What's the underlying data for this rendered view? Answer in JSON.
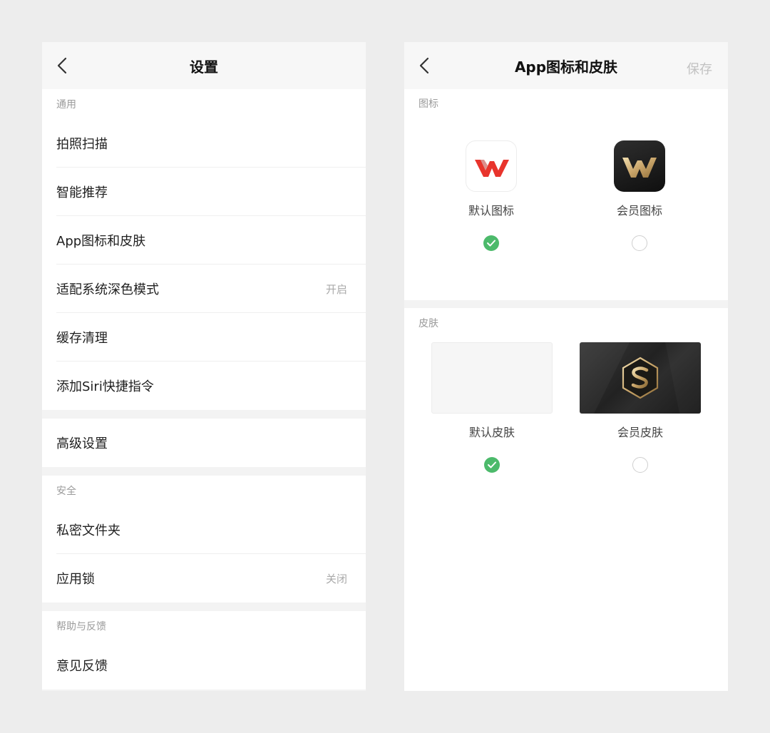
{
  "settings": {
    "title": "设置",
    "general": {
      "header": "通用",
      "items": [
        {
          "label": "拍照扫描",
          "value": ""
        },
        {
          "label": "智能推荐",
          "value": ""
        },
        {
          "label": "App图标和皮肤",
          "value": ""
        },
        {
          "label": "适配系统深色模式",
          "value": "开启"
        },
        {
          "label": "缓存清理",
          "value": ""
        },
        {
          "label": "添加Siri快捷指令",
          "value": ""
        }
      ]
    },
    "advanced": {
      "label": "高级设置"
    },
    "security": {
      "header": "安全",
      "items": [
        {
          "label": "私密文件夹",
          "value": ""
        },
        {
          "label": "应用锁",
          "value": "关闭"
        }
      ]
    },
    "help": {
      "header": "帮助与反馈",
      "items": [
        {
          "label": "意见反馈",
          "value": ""
        }
      ]
    }
  },
  "icon_skin": {
    "title": "App图标和皮肤",
    "save_label": "保存",
    "icons": {
      "header": "图标",
      "options": [
        {
          "label": "默认图标",
          "selected": true,
          "icon": "wps-default-icon"
        },
        {
          "label": "会员图标",
          "selected": false,
          "icon": "wps-member-icon"
        }
      ]
    },
    "skins": {
      "header": "皮肤",
      "options": [
        {
          "label": "默认皮肤",
          "selected": true
        },
        {
          "label": "会员皮肤",
          "selected": false
        }
      ]
    }
  },
  "colors": {
    "background": "#ededed",
    "check_green": "#4cba6b",
    "wps_red": "#e8342c",
    "member_gold": "#c9a56a"
  }
}
